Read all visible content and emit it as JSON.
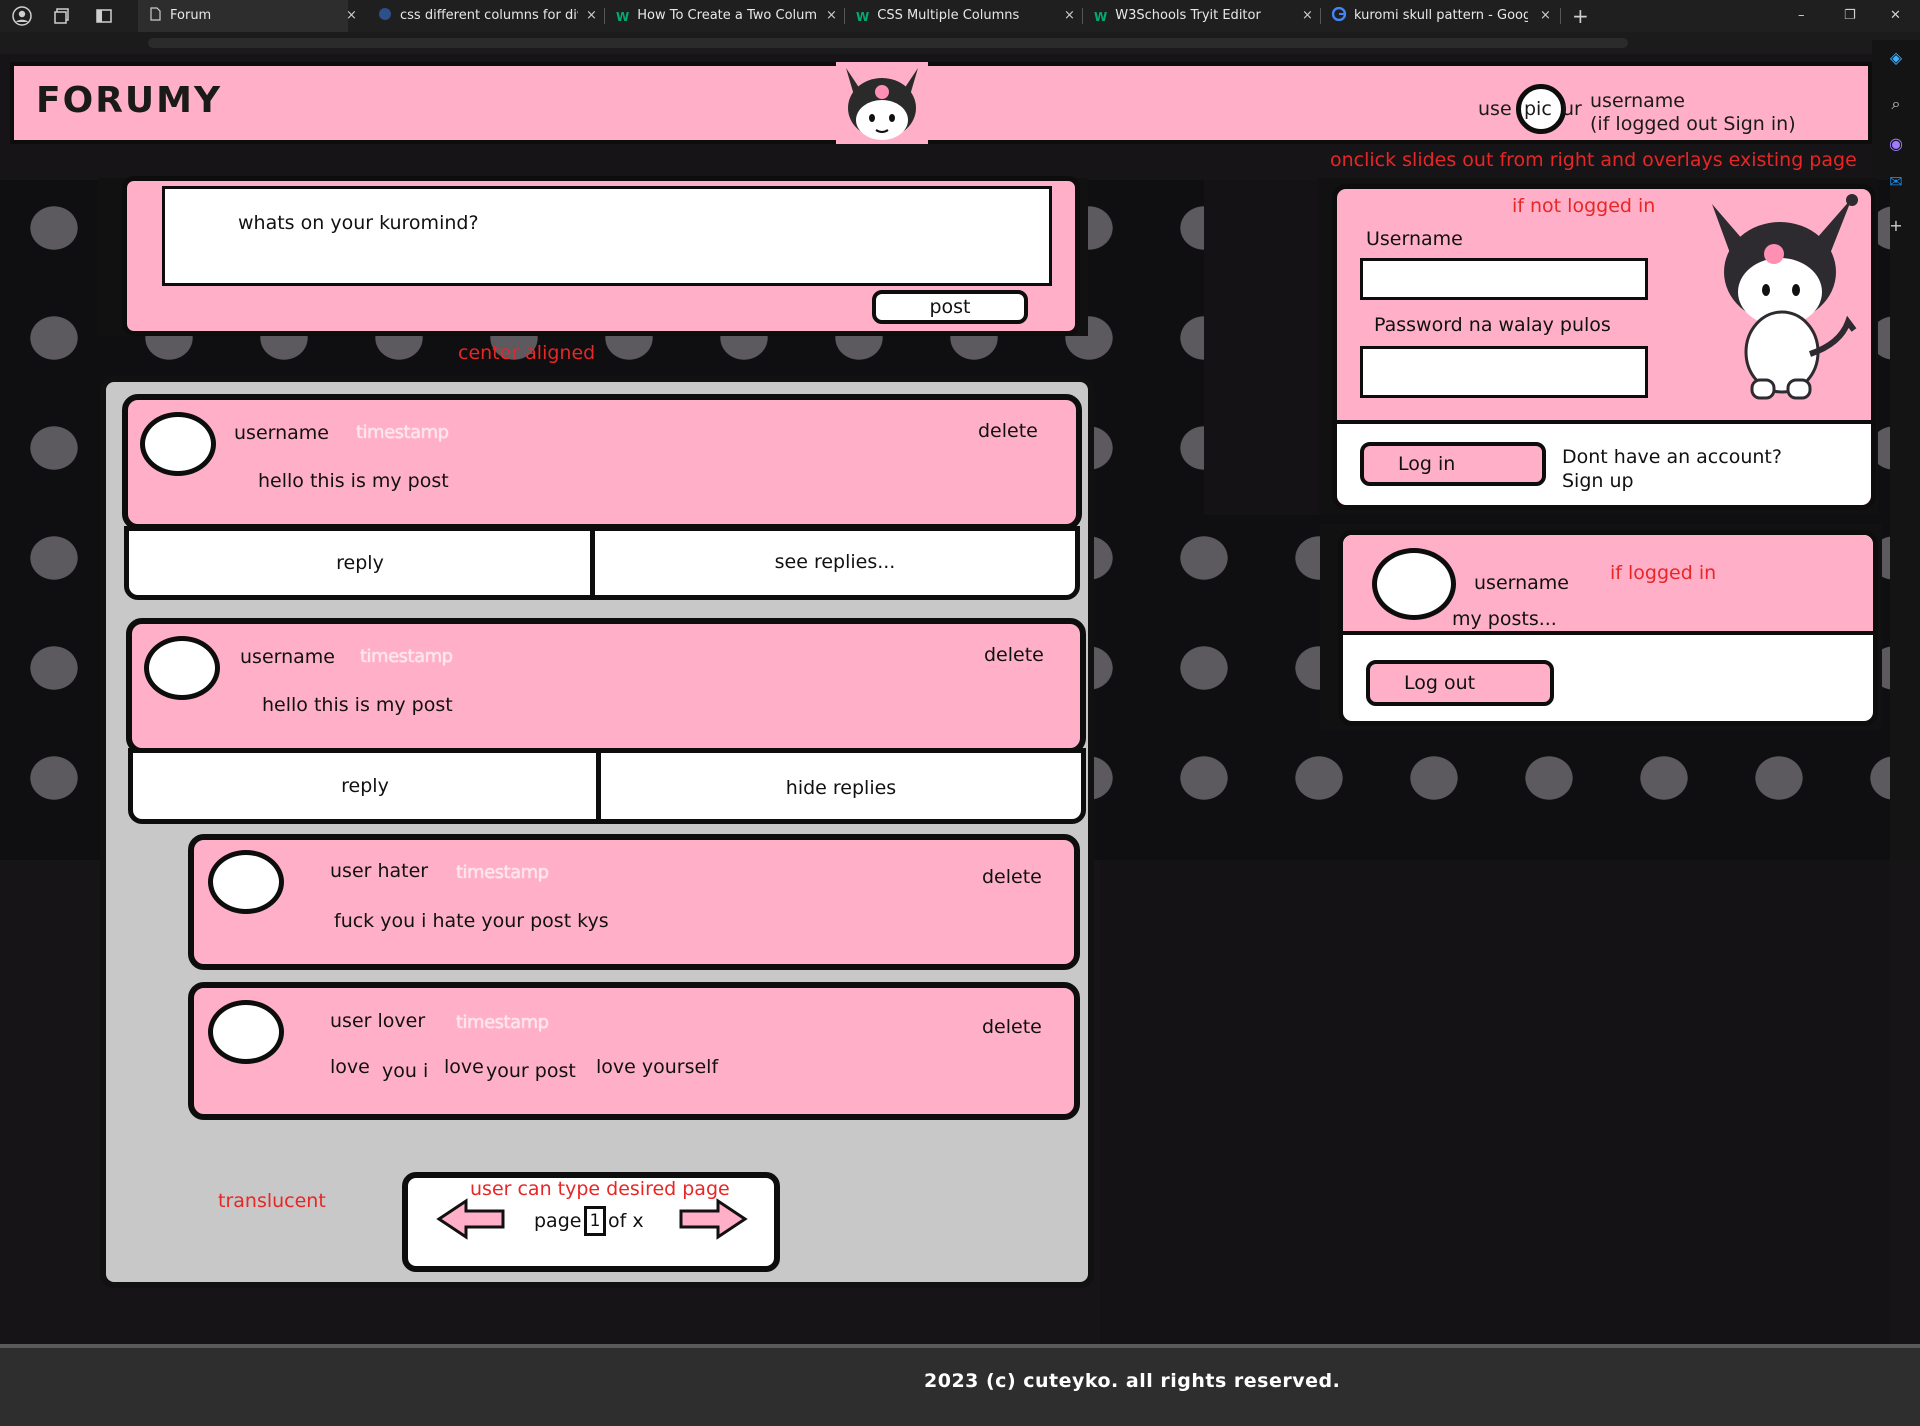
{
  "browser": {
    "tabs": [
      {
        "title": "Forum",
        "active": true
      },
      {
        "title": "css different columns for div - Se"
      },
      {
        "title": "How To Create a Two Column La"
      },
      {
        "title": "CSS Multiple Columns"
      },
      {
        "title": "W3Schools Tryit Editor"
      },
      {
        "title": "kuromi skull pattern - Google Se"
      }
    ],
    "close_glyph": "×",
    "new_tab_glyph": "+",
    "window_controls": [
      "–",
      "❐",
      "✕"
    ]
  },
  "header": {
    "logo": "FORUMY",
    "user_left": "use",
    "pic_label": "pic",
    "user_right": "ur",
    "username": "username",
    "signin_hint": "(if logged out Sign in)"
  },
  "notes": {
    "slide": "onclick slides out from right and overlays existing page",
    "center": "center aligned",
    "translucent": "translucent",
    "type_page": "user can type desired page"
  },
  "composer": {
    "placeholder": "whats on your kuromind?",
    "post_button": "post"
  },
  "posts": [
    {
      "username": "username",
      "timestamp": "timestamp",
      "delete": "delete",
      "body": "hello this is my post",
      "reply": "reply",
      "replies": "see replies..."
    },
    {
      "username": "username",
      "timestamp": "timestamp",
      "delete": "delete",
      "body": "hello this is my post",
      "reply": "reply",
      "replies": "hide replies"
    }
  ],
  "replies": [
    {
      "username": "user hater",
      "timestamp": "timestamp",
      "delete": "delete",
      "body": "fuck you i hate your post kys"
    },
    {
      "username": "user  lover",
      "timestamp": "timestamp",
      "delete": "delete",
      "body_parts": [
        "love",
        "you i",
        "love",
        "your post",
        "love yourself"
      ]
    }
  ],
  "pagination": {
    "page_label": "page",
    "page_value": "1",
    "of_label": "of x"
  },
  "login_panel": {
    "note": "if not logged in",
    "username_label": "Username",
    "password_label": "Password na walay pulos",
    "login_button": "Log in",
    "no_account": "Dont have an account?",
    "sign_up": "Sign up"
  },
  "logged_panel": {
    "username": "username",
    "note": "if logged in",
    "my_posts": "my posts...",
    "logout_button": "Log out"
  },
  "footer": {
    "text": "2023 (c) cuteyko. all rights reserved."
  },
  "colors": {
    "pink": "#ffb0c8",
    "note_red": "#e82626",
    "page_bg": "#161416",
    "feed_gray": "#c8c8c8"
  }
}
